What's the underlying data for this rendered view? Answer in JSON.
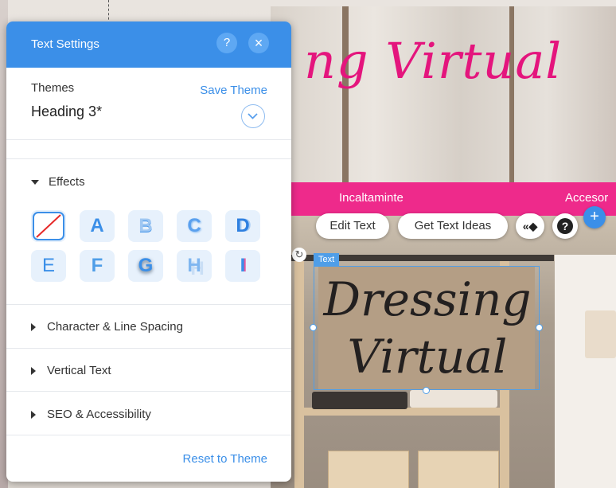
{
  "site": {
    "hero_title": "ng Virtual",
    "nav_items": [
      "Incaltaminte",
      "Accesor"
    ],
    "textbox_label": "Text",
    "textbox_lines": [
      "Dressing",
      "Virtual"
    ]
  },
  "toolbar": {
    "edit_text": "Edit Text",
    "get_text_ideas": "Get Text Ideas",
    "animation_glyph": "«◆",
    "help_glyph": "?",
    "add_glyph": "+"
  },
  "panel": {
    "title": "Text Settings",
    "help_glyph": "?",
    "close_glyph": "×",
    "themes_label": "Themes",
    "save_theme": "Save Theme",
    "theme_value": "Heading 3*",
    "effects_label": "Effects",
    "effects": [
      "A",
      "B",
      "C",
      "D",
      "E",
      "F",
      "G",
      "H",
      "I"
    ],
    "sections": [
      "Character & Line Spacing",
      "Vertical Text",
      "SEO & Accessibility"
    ],
    "reset_theme": "Reset to Theme"
  },
  "colors": {
    "accent": "#3b8fe8",
    "site_pink": "#ee2a8b",
    "title_pink": "#e4157d"
  }
}
